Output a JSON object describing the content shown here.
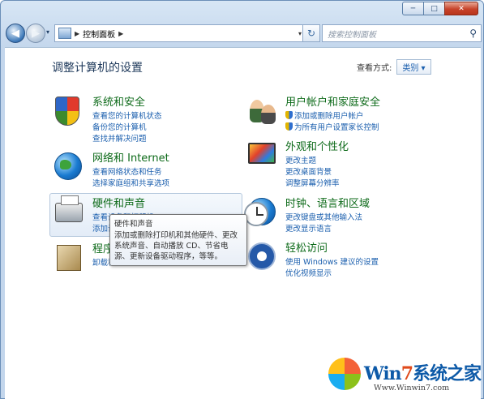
{
  "window": {
    "minimize_glyph": "─",
    "maximize_glyph": "□",
    "close_glyph": "✕"
  },
  "nav": {
    "back_glyph": "◀",
    "forward_glyph": "▶",
    "arrow": "▶",
    "breadcrumb": "控制面板",
    "refresh_glyph": "↻"
  },
  "search": {
    "placeholder": "搜索控制面板"
  },
  "main": {
    "title": "调整计算机的设置",
    "view_by_label": "查看方式:",
    "view_by_value": "类别 ▾"
  },
  "categories": [
    {
      "name": "系统和安全",
      "icon": "shield-icon",
      "links": [
        "查看您的计算机状态",
        "备份您的计算机",
        "查找并解决问题"
      ]
    },
    {
      "name": "网络和 Internet",
      "icon": "network-globe-icon",
      "links": [
        "查看网络状态和任务",
        "选择家庭组和共享选项"
      ]
    },
    {
      "name": "硬件和声音",
      "icon": "printer-icon",
      "links": [
        "查看设备和打印机",
        "添加设备"
      ]
    },
    {
      "name": "程序",
      "icon": "programs-icon",
      "links": [
        "卸载程序"
      ]
    },
    {
      "name": "用户帐户和家庭安全",
      "icon": "users-icon",
      "links": [
        "添加或删除用户帐户",
        "为所有用户设置家长控制"
      ]
    },
    {
      "name": "外观和个性化",
      "icon": "appearance-icon",
      "links": [
        "更改主题",
        "更改桌面背景",
        "调整屏幕分辨率"
      ]
    },
    {
      "name": "时钟、语言和区域",
      "icon": "clock-globe-icon",
      "links": [
        "更改键盘或其他输入法",
        "更改显示语言"
      ]
    },
    {
      "name": "轻松访问",
      "icon": "ease-of-access-icon",
      "links": [
        "使用 Windows 建议的设置",
        "优化视频显示"
      ]
    }
  ],
  "tooltip": {
    "title": "硬件和声音",
    "body": "添加或删除打印机和其他硬件、更改系统声音、自动播放 CD、节省电源、更新设备驱动程序，等等。"
  },
  "watermark": {
    "brand_a": "Win",
    "brand_b": "7",
    "brand_c": "系统之家",
    "url": "Www.Winwin7.com"
  }
}
